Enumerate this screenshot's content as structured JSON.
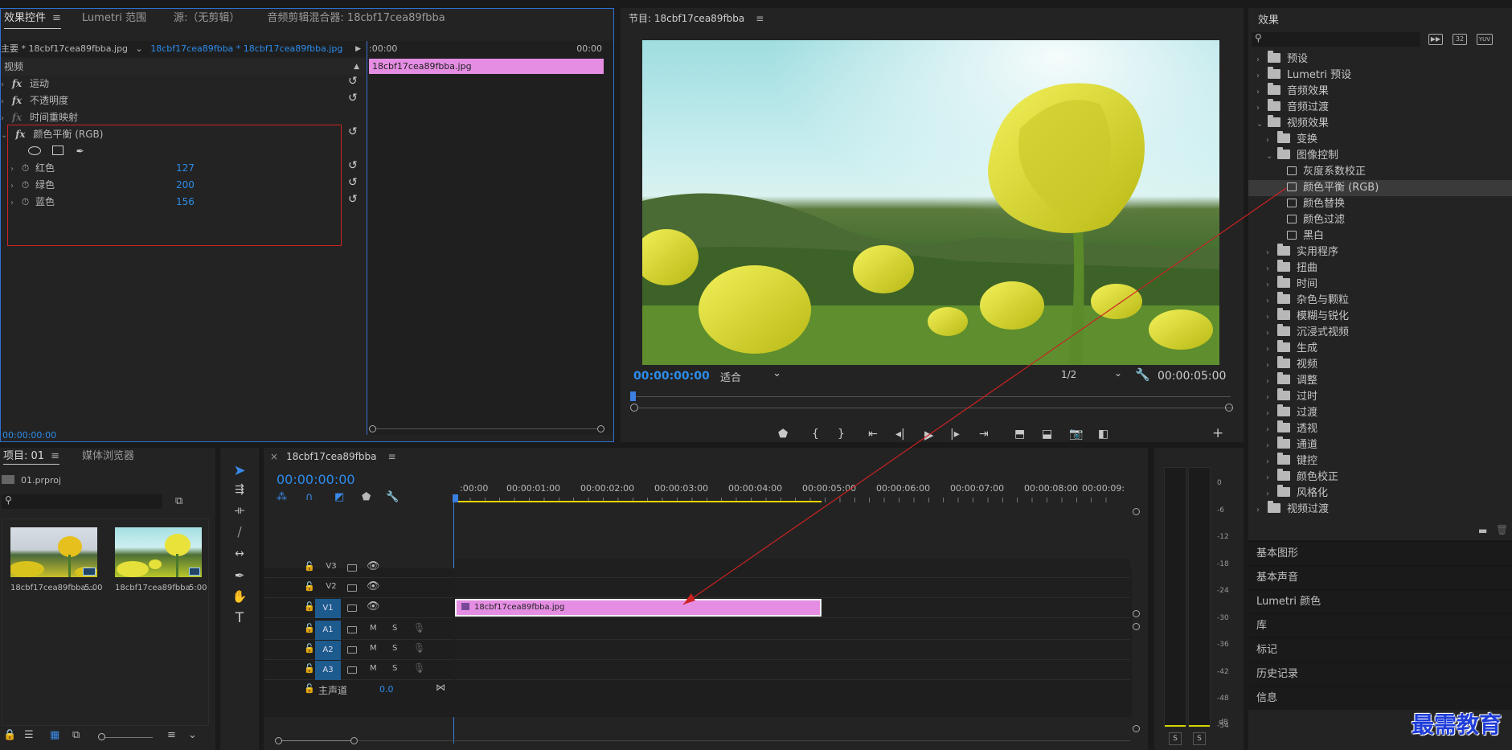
{
  "effect_controls": {
    "tabs": [
      {
        "label": "效果控件"
      },
      {
        "label": "Lumetri 范围"
      },
      {
        "label": "源:（无剪辑）"
      },
      {
        "label": "音频剪辑混合器: 18cbf17cea89fbba"
      }
    ],
    "master_label": "主要 * 18cbf17cea89fbba.jpg",
    "clip_label": "18cbf17cea89fbba * 18cbf17cea89fbba.jpg",
    "time_start": ":00:00",
    "time_end": "00:00",
    "clip_bar": "18cbf17cea89fbba.jpg",
    "video_label": "视频",
    "effects": [
      {
        "label": "运动"
      },
      {
        "label": "不透明度"
      },
      {
        "label": "时间重映射"
      },
      {
        "label": "颜色平衡 (RGB)"
      }
    ],
    "params": [
      {
        "label": "红色",
        "value": "127"
      },
      {
        "label": "绿色",
        "value": "200"
      },
      {
        "label": "蓝色",
        "value": "156"
      }
    ],
    "timecode": "00:00:00:00"
  },
  "program": {
    "title": "节目: 18cbf17cea89fbba",
    "timecode": "00:00:00:00",
    "fit_label": "适合",
    "quality": "1/2",
    "duration": "00:00:05:00"
  },
  "project": {
    "tabs": [
      {
        "label": "项目: 01"
      },
      {
        "label": "媒体浏览器"
      }
    ],
    "file": "01.prproj",
    "items": [
      {
        "name": "18cbf17cea89fbba....",
        "dur": "5:00"
      },
      {
        "name": "18cbf17cea89fbba",
        "dur": "5:00"
      }
    ]
  },
  "timeline": {
    "tab": "18cbf17cea89fbba",
    "timecode": "00:00:00:00",
    "ruler": [
      ":00:00",
      "00:00:01:00",
      "00:00:02:00",
      "00:00:03:00",
      "00:00:04:00",
      "00:00:05:00",
      "00:00:06:00",
      "00:00:07:00",
      "00:00:08:00",
      "00:00:09:"
    ],
    "tracks": [
      {
        "name": "V3"
      },
      {
        "name": "V2"
      },
      {
        "name": "V1"
      },
      {
        "name": "A1"
      },
      {
        "name": "A2"
      },
      {
        "name": "A3"
      }
    ],
    "mute": "M",
    "solo": "S",
    "master": "主声道",
    "master_val": "0.0",
    "clip": "18cbf17cea89fbba.jpg"
  },
  "meter": {
    "scale": [
      "0",
      "-6",
      "-12",
      "-18",
      "-24",
      "-30",
      "-36",
      "-42",
      "-48",
      "-54",
      "dB"
    ],
    "solo": "S"
  },
  "effects_panel": {
    "title": "效果",
    "badges": [
      "32",
      "YUV"
    ],
    "tree": [
      {
        "label": "预设",
        "level": 0,
        "kind": "bin"
      },
      {
        "label": "Lumetri 预设",
        "level": 0,
        "kind": "bin"
      },
      {
        "label": "音频效果",
        "level": 0,
        "kind": "folder"
      },
      {
        "label": "音频过渡",
        "level": 0,
        "kind": "folder"
      },
      {
        "label": "视频效果",
        "level": 0,
        "kind": "folder",
        "open": true
      },
      {
        "label": "变换",
        "level": 1,
        "kind": "folder"
      },
      {
        "label": "图像控制",
        "level": 1,
        "kind": "folder",
        "open": true
      },
      {
        "label": "灰度系数校正",
        "level": 2,
        "kind": "fx"
      },
      {
        "label": "颜色平衡 (RGB)",
        "level": 2,
        "kind": "fx",
        "selected": true
      },
      {
        "label": "颜色替换",
        "level": 2,
        "kind": "fx"
      },
      {
        "label": "颜色过滤",
        "level": 2,
        "kind": "fx"
      },
      {
        "label": "黑白",
        "level": 2,
        "kind": "fx"
      },
      {
        "label": "实用程序",
        "level": 1,
        "kind": "folder"
      },
      {
        "label": "扭曲",
        "level": 1,
        "kind": "folder"
      },
      {
        "label": "时间",
        "level": 1,
        "kind": "folder"
      },
      {
        "label": "杂色与颗粒",
        "level": 1,
        "kind": "folder"
      },
      {
        "label": "模糊与锐化",
        "level": 1,
        "kind": "folder"
      },
      {
        "label": "沉浸式视频",
        "level": 1,
        "kind": "folder"
      },
      {
        "label": "生成",
        "level": 1,
        "kind": "folder"
      },
      {
        "label": "视频",
        "level": 1,
        "kind": "folder"
      },
      {
        "label": "调整",
        "level": 1,
        "kind": "folder"
      },
      {
        "label": "过时",
        "level": 1,
        "kind": "folder"
      },
      {
        "label": "过渡",
        "level": 1,
        "kind": "folder"
      },
      {
        "label": "透视",
        "level": 1,
        "kind": "folder"
      },
      {
        "label": "通道",
        "level": 1,
        "kind": "folder"
      },
      {
        "label": "键控",
        "level": 1,
        "kind": "folder"
      },
      {
        "label": "颜色校正",
        "level": 1,
        "kind": "folder"
      },
      {
        "label": "风格化",
        "level": 1,
        "kind": "folder"
      },
      {
        "label": "视频过渡",
        "level": 0,
        "kind": "folder"
      }
    ],
    "sections": [
      {
        "label": "基本图形"
      },
      {
        "label": "基本声音"
      },
      {
        "label": "Lumetri 颜色"
      },
      {
        "label": "库"
      },
      {
        "label": "标记"
      },
      {
        "label": "历史记录"
      },
      {
        "label": "信息"
      }
    ]
  },
  "watermark": "最需教育",
  "colors": {
    "accent": "#2d8ceb",
    "clip": "#e58de3",
    "highlight": "#cc2222",
    "playhead": "#3b7fe0"
  }
}
